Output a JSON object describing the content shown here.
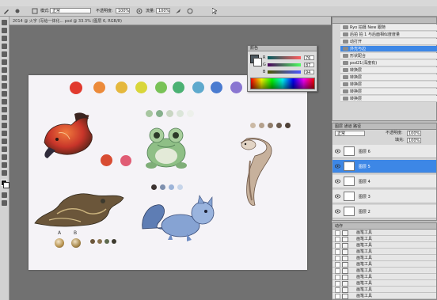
{
  "options_bar": {
    "mode_value": "正常",
    "opacity_label": "不透明度:",
    "opacity_value": "100%",
    "flow_label": "流量:",
    "flow_value": "100%"
  },
  "document": {
    "tab_title": "2014 @ 火字 (写给一体化... psd @ 33.3% (图层 6, RGB/8)"
  },
  "color_panel": {
    "title": "颜色",
    "channels": [
      {
        "label": "R",
        "value": "76"
      },
      {
        "label": "G",
        "value": "87"
      },
      {
        "label": "B",
        "value": "94"
      }
    ]
  },
  "history_panel": {
    "items": [
      {
        "label": "Ryo 拍摄 New 跟随"
      },
      {
        "label": "后拍 拍 1 与后面相似度度量"
      },
      {
        "label": "动打开"
      },
      {
        "label": "外光与边",
        "selected": true
      },
      {
        "label": "形状配合"
      },
      {
        "label": "psd21(深度有)"
      },
      {
        "label": "转换层"
      },
      {
        "label": "转换层"
      },
      {
        "label": "转换层"
      },
      {
        "label": "转换层"
      },
      {
        "label": "转换层"
      }
    ]
  },
  "layers_panel": {
    "tabs": "图层  通道  路径",
    "blend_mode": "正常",
    "opacity_label": "不透明度:",
    "opacity_value": "100%",
    "fill_label": "填充:",
    "fill_value": "100%",
    "layers": [
      {
        "name": "图层 6"
      },
      {
        "name": "图层 5",
        "selected": true
      },
      {
        "name": "图层 4"
      },
      {
        "name": "图层 3"
      },
      {
        "name": "图层 2"
      }
    ]
  },
  "actions_panel": {
    "title": "动作",
    "items": [
      {
        "label": "画笔工具"
      },
      {
        "label": "画笔工具"
      },
      {
        "label": "画笔工具"
      },
      {
        "label": "画笔工具"
      },
      {
        "label": "画笔工具"
      },
      {
        "label": "画笔工具"
      },
      {
        "label": "画笔工具"
      },
      {
        "label": "画笔工具"
      },
      {
        "label": "画笔工具"
      },
      {
        "label": "画笔工具"
      },
      {
        "label": "画笔工具"
      }
    ]
  },
  "canvas": {
    "letters": [
      "A",
      "B"
    ],
    "swatch_colors": [
      "#e13a2e",
      "#ec8a3a",
      "#e5b83d",
      "#d9d63a",
      "#79c257",
      "#4bb173",
      "#5ea9cd",
      "#4a7bd0",
      "#8a76d1"
    ],
    "frog_palette": [
      "#a7c6a0",
      "#86b08c",
      "#c9d6c3",
      "#dbe5d9",
      "#edf0eb"
    ],
    "snake_palette": [
      "#cbb9a5",
      "#b4a08c",
      "#8f7c6a",
      "#6a5a4d",
      "#4f4137"
    ],
    "squirrel_palette": [
      "#3c3230",
      "#7d8fae",
      "#9cb3d8",
      "#c7d5ea"
    ],
    "fish_palette": [
      "#d84c32",
      "#e05c74"
    ],
    "dragon_palette": [
      "#6b563a",
      "#8b7350",
      "#5e6a4e",
      "#3d3a2e"
    ]
  }
}
